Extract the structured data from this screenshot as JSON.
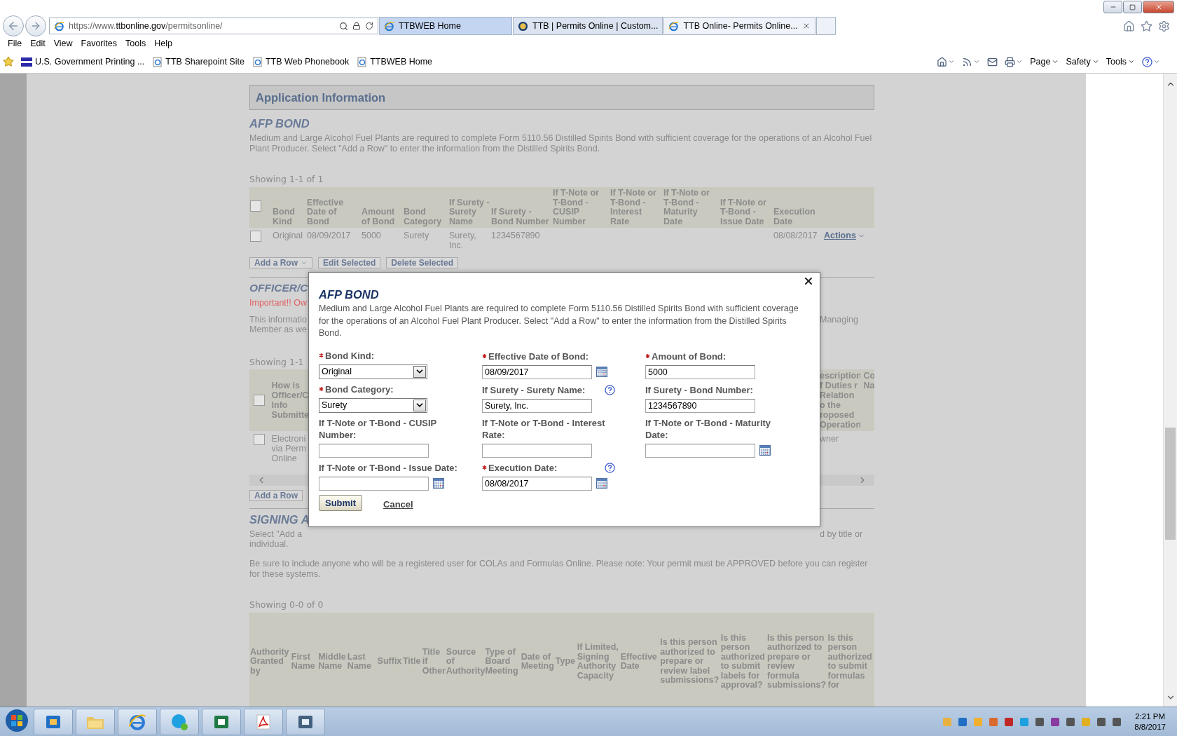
{
  "browser": {
    "address": {
      "prefix": "https://www.",
      "domain": "ttbonline.gov",
      "path": "/permitsonline/"
    },
    "tabs": [
      {
        "label": "TTBWEB Home",
        "selected": false,
        "hover": true
      },
      {
        "label": "TTB | Permits Online | Custom...",
        "selected": false,
        "hover": false
      },
      {
        "label": "TTB Online- Permits Online...",
        "selected": true,
        "hover": false
      }
    ],
    "menu": [
      "File",
      "Edit",
      "View",
      "Favorites",
      "Tools",
      "Help"
    ],
    "favorites": [
      {
        "label": "U.S. Government Printing ...",
        "kind": "gpo"
      },
      {
        "label": "TTB Sharepoint Site",
        "kind": "page"
      },
      {
        "label": "TTB Web Phonebook",
        "kind": "page"
      },
      {
        "label": "TTBWEB Home",
        "kind": "page"
      }
    ],
    "command_menus": [
      "Page",
      "Safety",
      "Tools"
    ]
  },
  "page": {
    "header": "Application Information",
    "afp_bond": {
      "title": "AFP BOND",
      "description": "Medium and Large Alcohol Fuel Plants are required to complete Form 5110.56 Distilled Spirits Bond with sufficient coverage for the operations of an Alcohol Fuel Plant Producer. Select \"Add a Row\" to enter the information from the Distilled Spirits Bond.",
      "showing": "Showing 1-1 of 1",
      "select_all_checked": false,
      "columns": [
        "Bond Kind",
        "Effective Date of Bond",
        "Amount of Bond",
        "Bond Category",
        "If Surety - Surety Name",
        "If Surety - Bond Number",
        "If T-Note or T-Bond - CUSIP Number",
        "If T-Note or T-Bond - Interest Rate",
        "If T-Note or T-Bond - Maturity Date",
        "If T-Note or T-Bond - Issue Date",
        "Execution Date"
      ],
      "rows": [
        {
          "checked": false,
          "cells": [
            "Original",
            "08/09/2017",
            "5000",
            "Surety",
            "Surety, Inc.",
            "1234567890",
            "",
            "",
            "",
            "",
            "08/08/2017"
          ],
          "action": "Actions"
        }
      ],
      "buttons": [
        "Add a Row",
        "Edit Selected",
        "Delete Selected"
      ]
    },
    "officer": {
      "title": "OFFICER/C",
      "important": "Important!! Ow",
      "info_left": "This informatio Member as we",
      "info_right": "Managing",
      "showing": "Showing 1-1",
      "select_all_checked": false,
      "header_left": "How is Officer/C Info Submitte",
      "header_right": "escription f Duties r Relation o the roposed Operation",
      "header_cut": "Co Na",
      "rows": [
        {
          "checked": false,
          "left": "Electroni via Perm Online",
          "right": "wner"
        }
      ],
      "button": "Add a Row"
    },
    "signing": {
      "title": "SIGNING A",
      "select_left": "Select \"Add a",
      "select_right": "d by title or",
      "select_line2": "individual.",
      "note": "Be sure to include anyone who will be a registered user for COLAs and Formulas Online. Please note: Your permit must be APPROVED before you can register for these systems.",
      "showing": "Showing 0-0 of 0",
      "columns": [
        "Authority Granted by",
        "First Name",
        "Middle Name",
        "Last Name",
        "Suffix",
        "Title",
        "Title if Other",
        "Source of Authority",
        "Type of Board Meeting",
        "Date of Meeting",
        "Type",
        "If Limited, Signing Authority Capacity",
        "Effective Date",
        "Is this person authorized to prepare or review label submissions?",
        "Is this person authorized to submit labels for approval?",
        "Is this person authorized to prepare or review formula submissions?",
        "Is this person authorized to submit formulas for"
      ]
    }
  },
  "modal": {
    "title": "AFP BOND",
    "description": "Medium and Large Alcohol Fuel Plants are required to complete Form 5110.56 Distilled Spirits Bond with sufficient coverage for the operations of an Alcohol Fuel Plant Producer. Select \"Add a Row\" to enter the information from the Distilled Spirits Bond.",
    "fields": [
      {
        "label": "Bond Kind:",
        "required": true,
        "help": false,
        "kind": "select",
        "value": "Original"
      },
      {
        "label": "Effective Date of Bond:",
        "required": true,
        "help": false,
        "kind": "date",
        "value": "08/09/2017"
      },
      {
        "label": "Amount of Bond:",
        "required": true,
        "help": false,
        "kind": "text",
        "value": "5000"
      },
      {
        "label": "Bond Category:",
        "required": true,
        "help": false,
        "kind": "select",
        "value": "Surety"
      },
      {
        "label": "If Surety - Surety Name:",
        "required": false,
        "help": true,
        "kind": "text",
        "value": "Surety, Inc."
      },
      {
        "label": "If Surety - Bond Number:",
        "required": false,
        "help": false,
        "kind": "text",
        "value": "1234567890"
      },
      {
        "label": "If T-Note or T-Bond - CUSIP Number:",
        "required": false,
        "help": false,
        "kind": "text"
      },
      {
        "label": "If T-Note or T-Bond - Interest Rate:",
        "required": false,
        "help": false,
        "kind": "text"
      },
      {
        "label": "If T-Note or T-Bond - Maturity Date:",
        "required": false,
        "help": false,
        "kind": "date"
      },
      {
        "label": "If T-Note or T-Bond - Issue Date:",
        "required": false,
        "help": false,
        "kind": "date"
      },
      {
        "label": "Execution Date:",
        "required": true,
        "help": true,
        "kind": "date",
        "value": "08/08/2017"
      }
    ],
    "submit": "Submit",
    "cancel": "Cancel"
  },
  "taskbar": {
    "time": "2:21 PM",
    "date": "8/8/2017"
  }
}
